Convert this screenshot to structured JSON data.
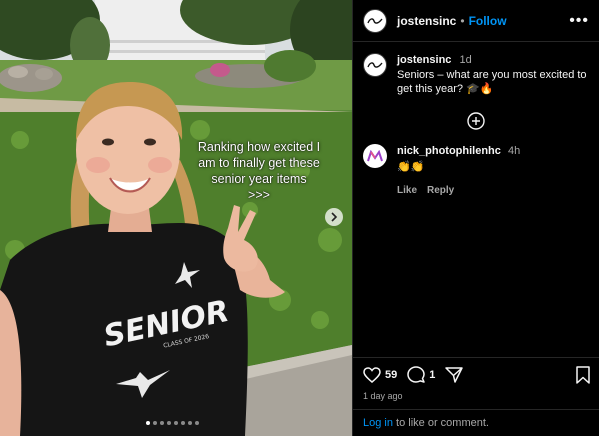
{
  "media": {
    "overlay_lines": [
      "Ranking how excited I",
      "am to finally get these",
      "senior year items",
      ">>>"
    ],
    "shirt_text": "SENIOR",
    "shirt_subtext": "CLASS OF 2026",
    "carousel_count": 8,
    "carousel_active_index": 0,
    "next_icon": "chevron-right-icon"
  },
  "header": {
    "username": "jostensinc",
    "separator": "•",
    "follow_label": "Follow",
    "more_label": "•••"
  },
  "caption": {
    "username": "jostensinc",
    "age": "1d",
    "text": "Seniors – what are you most excited to get this year? 🎓🔥"
  },
  "comments": [
    {
      "username": "nick_photophilenhc",
      "age": "4h",
      "text": "👏👏",
      "like_label": "Like",
      "reply_label": "Reply"
    }
  ],
  "actions": {
    "likes": "59",
    "comments": "1",
    "time": "1 day ago"
  },
  "login": {
    "link_label": "Log in",
    "rest": " to like or comment."
  },
  "colors": {
    "background": "#000000",
    "accent": "#0095f6",
    "muted": "#a8a8a8",
    "divider": "#262626"
  }
}
